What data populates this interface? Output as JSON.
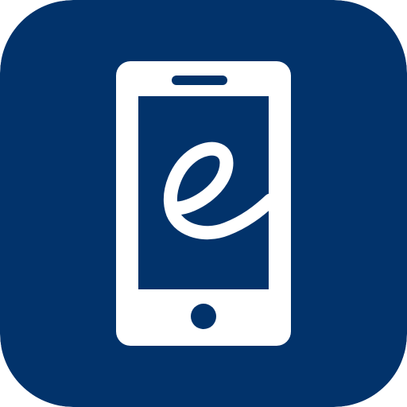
{
  "icon": {
    "name": "mobile-e-app-icon",
    "glyph_icon": "script-e-icon",
    "device_icon": "smartphone-icon"
  },
  "colors": {
    "background": "#02336B",
    "phone_body": "#FFFFFF",
    "screen": "#02336B",
    "glyph": "#FFFFFF"
  }
}
